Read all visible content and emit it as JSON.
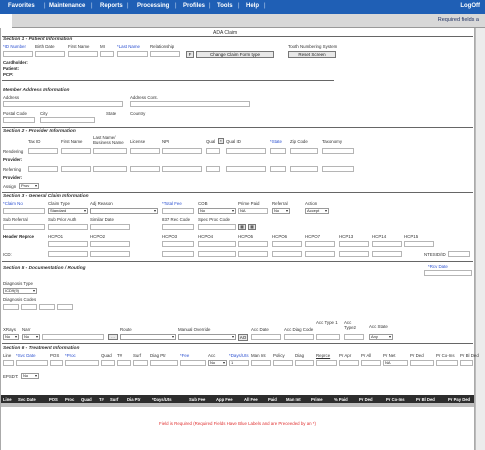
{
  "nav": {
    "items": [
      "Favorites",
      "Maintenance",
      "Reports",
      "Processing",
      "Profiles",
      "Tools",
      "Help"
    ],
    "logoff": "LogOff",
    "required_note": "Required fields a"
  },
  "form": {
    "title": "ADA Claim",
    "s1": {
      "heading": "Section 1 - Patient Information",
      "labels": [
        "*ID Number",
        "Birth Date",
        "First Name",
        "MI",
        "*Last Name",
        "Relationship",
        "Tooth Numbering System"
      ],
      "f_btn": "F",
      "change_btn": "Change Claim Form type",
      "reset_btn": "Reset Screen",
      "cardholder": "Cardholder:",
      "patient": "Patient:",
      "pcp": "PCP:"
    },
    "member": {
      "heading": "Member Address Information",
      "address": "Address",
      "address_cont": "Address Cont.",
      "postal": "Postal Code",
      "city": "City",
      "state": "State",
      "country": "Country"
    },
    "s2": {
      "heading": "Section 2 - Provider Information",
      "cols": [
        "Tax ID",
        "First Name",
        "Last Name/ Business Name",
        "License",
        "NPI",
        "Qual",
        "Qual ID",
        "*State",
        "Zip Code",
        "Taxonomy"
      ],
      "rendering": "Rendering",
      "provider": "Provider:",
      "referring": "Referring",
      "provider2": "Provider:",
      "assign": "Assign",
      "assign_val": "Prov"
    },
    "s3": {
      "heading": "Section 3 - General Claim Information",
      "r1": [
        "*Claim No",
        "Claim Type",
        "Adj Reason",
        "*Total Fee",
        "COB",
        "Prime Paid",
        "Referral",
        "Action"
      ],
      "claim_type_val": "Standard",
      "cob_val": "No",
      "prime_val": "NA",
      "referral_val": "No",
      "action_val": "Accept",
      "r2": [
        "Sub Referral",
        "Sub Prior Auth",
        "Similar Date",
        "837 Rec Code",
        "Spec Proc Code"
      ],
      "hcpcs_head": "Header Reprce",
      "hcpcs": [
        "HCPO1",
        "HCPO2",
        "HCPO3",
        "HCPO4",
        "HCPO5",
        "HCPO6",
        "HCPO7",
        "HCP13",
        "HCP14",
        "HCP15"
      ],
      "icd": "ICD:",
      "ntesid": "NTESID/ID"
    },
    "s5": {
      "heading": "Section 5 - Documentation / Routing",
      "rov_date": "*Rcv Date",
      "diag_type": "Diagnosis Type",
      "diag_type_val": "ICD9(9)",
      "diag_codes": "Diagnosis Codes",
      "labels": [
        "XRays",
        "Narr",
        "Route",
        "Manual Override",
        "Acc Date",
        "Acc Diag Code",
        "Acc Type 1",
        "Acc Type2",
        "Acc State"
      ],
      "xrays_val": "No",
      "narr_val": "No",
      "acc_state_val": "Any",
      "ao": "AO"
    },
    "s6": {
      "heading": "Section 6 - Treatment Information",
      "labels": [
        "Line",
        "*Svc Date",
        "POS",
        "*Proc",
        "Quad",
        "T#",
        "Surf",
        "Diag Ptr",
        "*Fee",
        "Acc",
        "*Days/Uts",
        "Man Int",
        "Policy",
        "Diag",
        "Reprce",
        "Pr Apr",
        "Pr All",
        "Pr Net",
        "Pr Ded",
        "Pr Co-Ins",
        "Pr Bl Ded"
      ],
      "acc_val": "No",
      "days_val": "1",
      "prnet_val": "NA",
      "epsdt": "EPSDT:",
      "epsdt_val": "No"
    },
    "grid": {
      "headers": [
        "Line",
        "Svc Date",
        "POS",
        "Proc",
        "Quad",
        "T#",
        "Surf",
        "Dia Ptr",
        "*Days/Uts",
        "Sub Fee",
        "App Fee",
        "All Fee",
        "Paid",
        "Man Int",
        "Prime",
        "% Paid",
        "Pr Ded",
        "Pr Co-Ins",
        "Pr Bl Ded",
        "Pr Pay Ded"
      ]
    },
    "footnote": "Field is Required (Required Fields Have Blue Labels and are Preceeded by an *)"
  }
}
